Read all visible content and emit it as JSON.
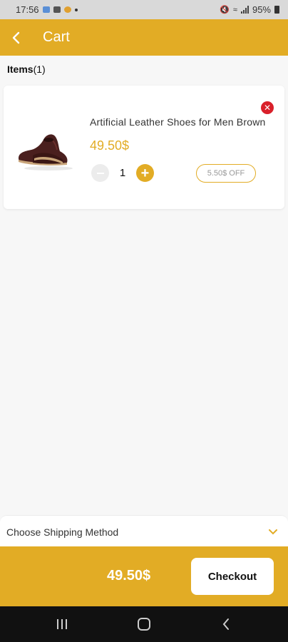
{
  "status_bar": {
    "time": "17:56",
    "battery": "95%"
  },
  "header": {
    "title": "Cart",
    "back_icon": "arrow-back-icon"
  },
  "items_header": {
    "label": "Items",
    "count": "(1)"
  },
  "cart_items": [
    {
      "name": "Artificial Leather Shoes for Men Brown",
      "price": "49.50$",
      "quantity": "1",
      "discount": "5.50$ OFF",
      "remove_icon": "close-icon"
    }
  ],
  "shipping": {
    "label": "Choose Shipping Method",
    "icon": "chevron-down-icon"
  },
  "checkout": {
    "total": "49.50$",
    "button_label": "Checkout"
  },
  "colors": {
    "accent": "#e2ac25",
    "remove": "#d9202a",
    "background": "#f7f7f7"
  },
  "system_nav": {
    "icons": [
      "recents-icon",
      "home-icon",
      "back-icon"
    ]
  }
}
